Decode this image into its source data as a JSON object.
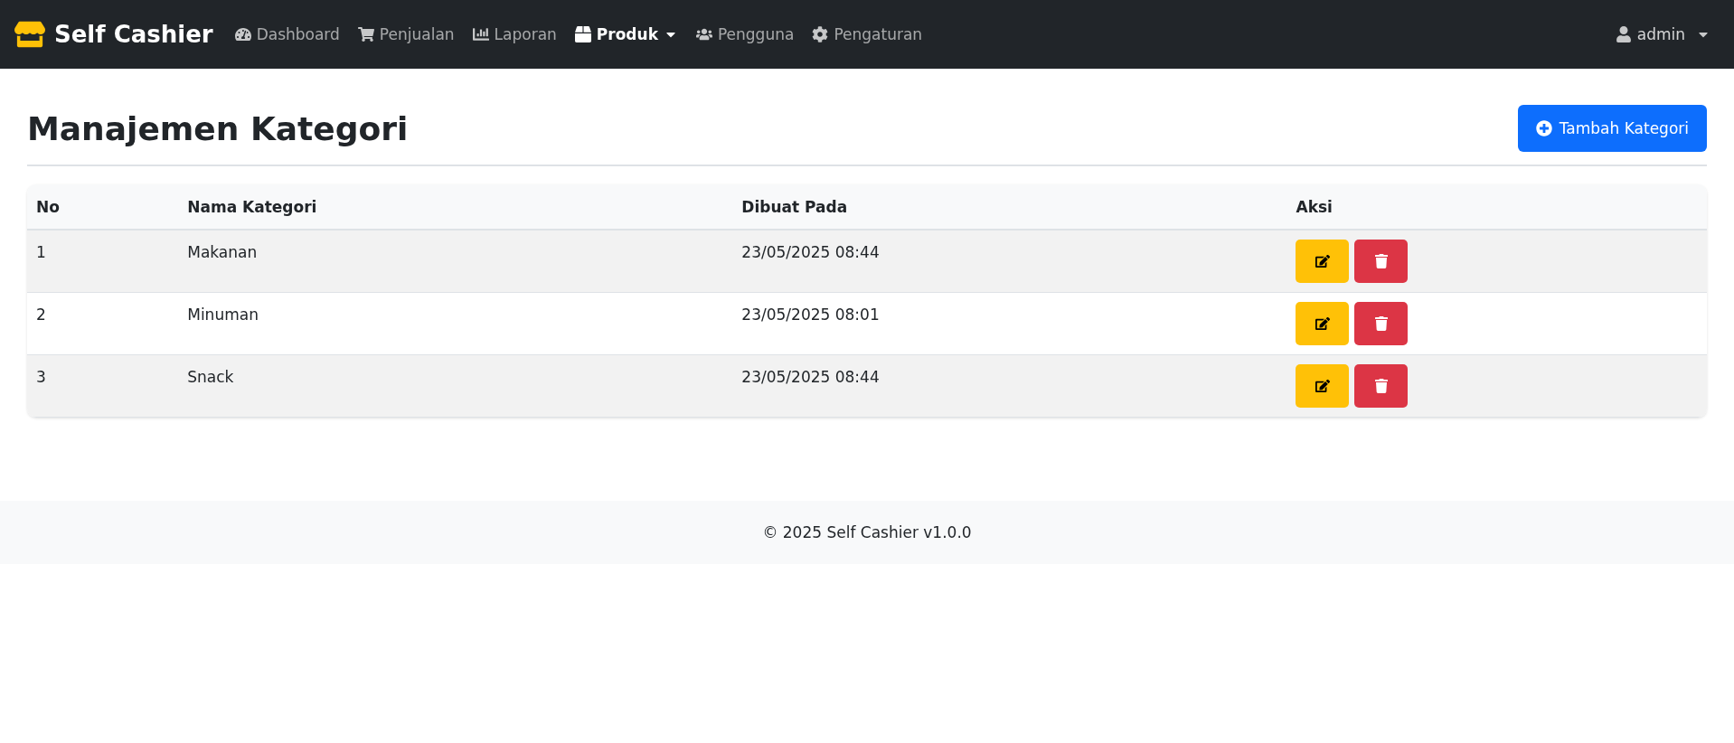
{
  "navbar": {
    "brand": "Self Cashier",
    "items": [
      {
        "label": "Dashboard",
        "selected": false,
        "dropdown": false
      },
      {
        "label": "Penjualan",
        "selected": false,
        "dropdown": false
      },
      {
        "label": "Laporan",
        "selected": false,
        "dropdown": false
      },
      {
        "label": "Produk",
        "selected": true,
        "dropdown": true
      },
      {
        "label": "Pengguna",
        "selected": false,
        "dropdown": false
      },
      {
        "label": "Pengaturan",
        "selected": false,
        "dropdown": false
      }
    ],
    "user": "admin"
  },
  "page": {
    "title": "Manajemen Kategori",
    "add_button": "Tambah Kategori"
  },
  "table": {
    "columns": [
      "No",
      "Nama Kategori",
      "Dibuat Pada",
      "Aksi"
    ],
    "rows": [
      {
        "no": "1",
        "name": "Makanan",
        "created": "23/05/2025 08:44"
      },
      {
        "no": "2",
        "name": "Minuman",
        "created": "23/05/2025 08:01"
      },
      {
        "no": "3",
        "name": "Snack",
        "created": "23/05/2025 08:44"
      }
    ]
  },
  "footer": "© 2025 Self Cashier v1.0.0"
}
